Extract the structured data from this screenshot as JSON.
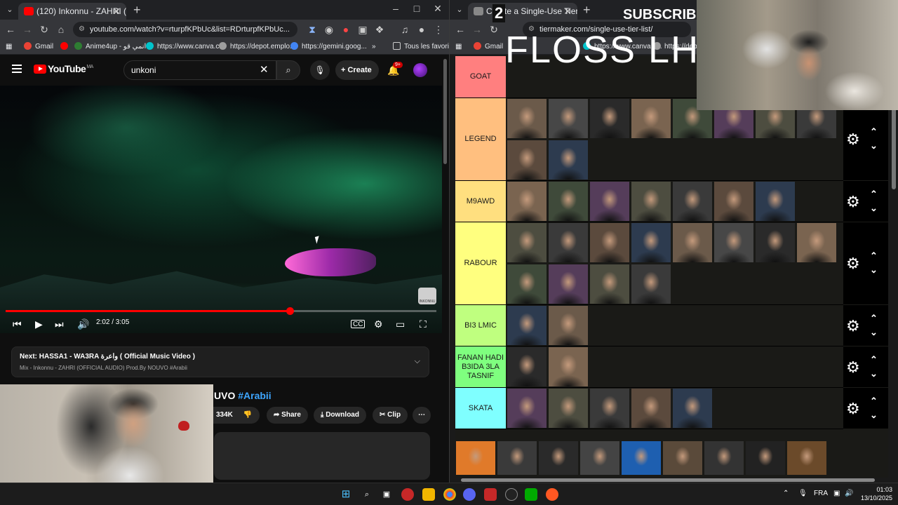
{
  "left_browser": {
    "tab_title": "(120) Inkonnu - ZAHRI (OF",
    "url": "youtube.com/watch?v=rturpfKPbUc&list=RDrturpfKPbUc...",
    "bookmarks": [
      "Gmail",
      "Anime4up - انمي قو...",
      "https://www.canva.c...",
      "https://depot.emplo...",
      "https://gemini.goog...",
      "Tous les favoris"
    ]
  },
  "youtube": {
    "logo": "YouTube",
    "region": "MA",
    "search_value": "unkoni",
    "create_label": "Create",
    "notif_badge": "9+",
    "player": {
      "time": "2:02 / 3:05",
      "progress_fraction": 0.659,
      "watermark": "INKONNU"
    },
    "next": {
      "label": "Next: HASSA1 - WA3RA واعرة ( Official Music Video )",
      "sub": "Mix - Inkonnu - ZAHRI (OFFICIAL AUDIO) Prod.By NOUVO #Arabii"
    },
    "title_tail": "UVO",
    "title_tag": "#Arabii",
    "likes": "334K",
    "share_label": "Share",
    "download_label": "Download",
    "clip_label": "Clip",
    "more_label": "⋯"
  },
  "right_browser": {
    "tab_title": "Create a Single-Use Tier List (Pr",
    "url": "tiermaker.com/single-use-tier-list/",
    "bookmarks": [
      "Gmail",
      "https://www.canva.c...",
      "https://depo..."
    ]
  },
  "overlay": {
    "big_text": "FLOSS LHS",
    "subscribe": "SUBSCRIBE",
    "tag": "2"
  },
  "tiers": [
    {
      "label": "GOAT",
      "color": "#ff7f7f",
      "count": 0
    },
    {
      "label": "LEGEND",
      "color": "#ffbf7f",
      "count": 10
    },
    {
      "label": "M9AWD",
      "color": "#ffdf7f",
      "count": 7
    },
    {
      "label": "RABOUR",
      "color": "#ffff7f",
      "count": 12
    },
    {
      "label": "BI3 LMIC",
      "color": "#bfff7f",
      "count": 2
    },
    {
      "label": "FANAN HADI B3IDA 3LA TASNIF",
      "color": "#7fff7f",
      "count": 2
    },
    {
      "label": "SKATA",
      "color": "#7fffff",
      "count": 5
    }
  ],
  "pool_count": 9,
  "taskbar": {
    "lang": "FRA",
    "time": "01:03",
    "date": "13/10/2025"
  }
}
